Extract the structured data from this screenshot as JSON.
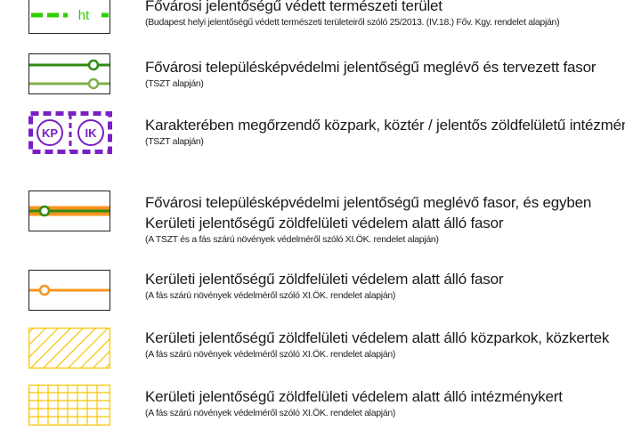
{
  "legend": {
    "items": [
      {
        "symbol": "protected-nature-area-icon",
        "symbol_text": "ht",
        "title_lines": [
          "Fővárosi jelentőségű védett természeti terület"
        ],
        "note": "(Budapest helyi jelentőségű védett természeti területeiről szóló 25/2013. (IV.18.) Főv. Kgy. rendelet alapján)"
      },
      {
        "symbol": "capital-tree-row-icon",
        "title_lines": [
          "Fővárosi településképvédelmi jelentőségű meglévő és tervezett fasor"
        ],
        "note": "(TSZT alapján)"
      },
      {
        "symbol": "central-park-institutional-green-icon",
        "symbol_text_left": "KP",
        "symbol_text_right": "IK",
        "title_lines": [
          "Karakterében megőrzendő közpark, köztér / jelentős zöldfelületű intézmény"
        ],
        "note": "(TSZT alapján)"
      },
      {
        "symbol": "combined-tree-row-icon",
        "title_lines": [
          "Fővárosi településképvédelmi jelentőségű meglévő fasor, és egyben",
          "Kerületi jelentőségű zöldfelületi védelem alatt álló fasor"
        ],
        "note": "(A TSZT és a fás szárú növények védelméről szóló XI.ÖK. rendelet alapján)"
      },
      {
        "symbol": "district-tree-row-icon",
        "title_lines": [
          "Kerületi jelentőségű zöldfelületi védelem alatt álló fasor"
        ],
        "note": "(A fás szárú növények védelméről szóló XI.ÖK. rendelet alapján)"
      },
      {
        "symbol": "district-park-hatch-icon",
        "title_lines": [
          "Kerületi jelentőségű zöldfelületi védelem alatt álló közparkok, közkertek"
        ],
        "note": "(A fás szárú növények védelméről szóló XI.ÖK. rendelet alapján)"
      },
      {
        "symbol": "institutional-garden-grid-icon",
        "title_lines": [
          "Kerületi jelentőségű zöldfelületi védelem alatt álló intézménykert"
        ],
        "note": "(A fás szárú növények védelméről szóló XI.ÖK. rendelet alapján)"
      }
    ]
  },
  "colors": {
    "green_bright": "#33cc00",
    "green_dark": "#2e8b12",
    "green_light": "#7fb04a",
    "purple": "#7a1fc4",
    "orange": "#f7941d",
    "yellow": "#f7c500"
  }
}
